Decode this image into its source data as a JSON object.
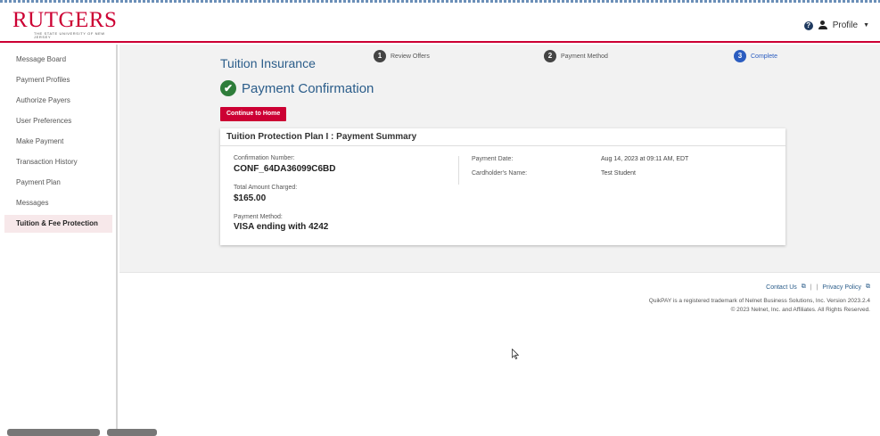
{
  "header": {
    "logo_text": "RUTGERS",
    "logo_subtitle": "THE STATE UNIVERSITY OF NEW JERSEY",
    "help_icon_glyph": "?",
    "profile_label": "Profile",
    "caret_glyph": "▼"
  },
  "sidebar": {
    "items": [
      {
        "label": "Message Board"
      },
      {
        "label": "Payment Profiles"
      },
      {
        "label": "Authorize Payers"
      },
      {
        "label": "User Preferences"
      },
      {
        "label": "Make Payment"
      },
      {
        "label": "Transaction History"
      },
      {
        "label": "Payment Plan"
      },
      {
        "label": "Messages"
      },
      {
        "label": "Tuition & Fee Protection",
        "active": true
      }
    ]
  },
  "main": {
    "page_title": "Tuition Insurance",
    "confirmation_title": "Payment Confirmation",
    "check_glyph": "✔",
    "continue_button": "Continue to Home",
    "steps": [
      {
        "number": "1",
        "label": "Review Offers"
      },
      {
        "number": "2",
        "label": "Payment Method"
      },
      {
        "number": "3",
        "label": "Complete",
        "current": true
      }
    ]
  },
  "summary": {
    "title": "Tuition Protection Plan I : Payment Summary",
    "confirmation_number_label": "Confirmation Number:",
    "confirmation_number": "CONF_64DA36099C6BD",
    "total_label": "Total Amount Charged:",
    "total": "$165.00",
    "payment_method_label": "Payment Method:",
    "payment_method": "VISA ending with 4242",
    "payment_date_label": "Payment Date:",
    "payment_date": "Aug 14, 2023 at 09:11 AM, EDT",
    "cardholder_label": "Cardholder's Name:",
    "cardholder": "Test Student"
  },
  "footer": {
    "contact_us": "Contact Us",
    "privacy_policy": "Privacy Policy",
    "link_separator": "|",
    "ext_glyph": "⧉",
    "trademark": "QuikPAY is a registered trademark of Nelnet Business Solutions, Inc. Version 2023.2.4",
    "copyright": "© 2023 Nelnet, Inc. and Affiliates. All Rights Reserved."
  },
  "colors": {
    "brand_red": "#cc0033",
    "link_blue": "#2b5d8a",
    "current_step_blue": "#2b5dc0",
    "success_green": "#2e7d3a"
  }
}
